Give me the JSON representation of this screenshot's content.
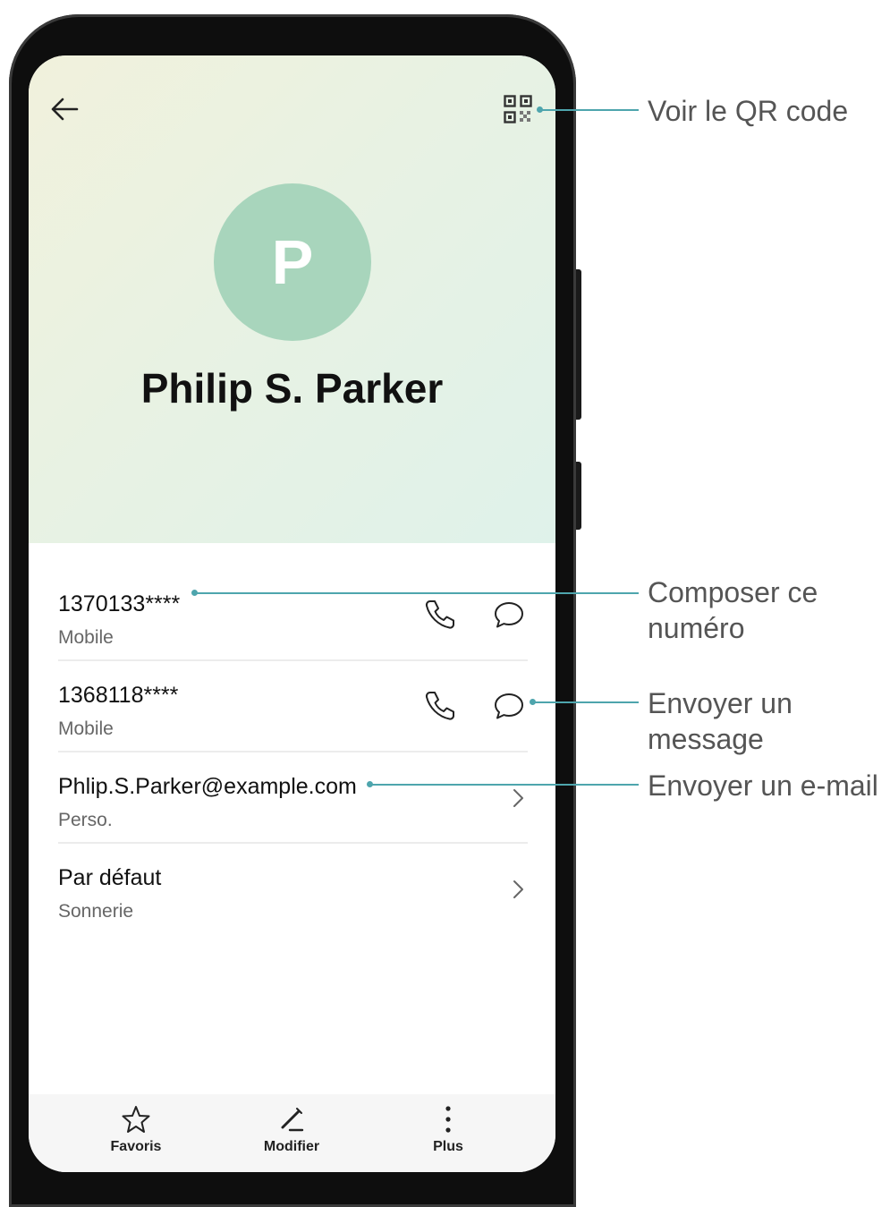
{
  "contact": {
    "initial": "P",
    "name": "Philip S. Parker",
    "avatar_color": "#a8d5bc"
  },
  "rows": [
    {
      "primary": "1370133****",
      "secondary": "Mobile"
    },
    {
      "primary": "1368118****",
      "secondary": "Mobile"
    },
    {
      "primary": "Phlip.S.Parker@example.com",
      "secondary": "Perso."
    },
    {
      "primary": "Par défaut",
      "secondary": "Sonnerie"
    }
  ],
  "bottom_bar": {
    "favoris": "Favoris",
    "modifier": "Modifier",
    "plus": "Plus"
  },
  "callouts": {
    "qr": "Voir le QR code",
    "call_line1": "Composer ce",
    "call_line2": "numéro",
    "msg_line1": "Envoyer un",
    "msg_line2": "message",
    "email": "Envoyer un e-mail"
  },
  "colors": {
    "accent": "#4ea5ad",
    "header_gradient_start": "#f1f1dc",
    "header_gradient_end": "#dff2ea"
  },
  "icons": [
    "back-arrow-icon",
    "qr-code-icon",
    "phone-icon",
    "message-icon",
    "chevron-right-icon",
    "star-icon",
    "pencil-icon",
    "more-vertical-icon"
  ]
}
